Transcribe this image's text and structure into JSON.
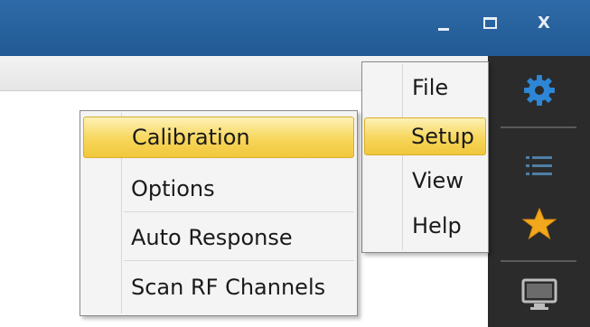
{
  "window": {
    "minimize_icon": "minimize-icon",
    "maximize_icon": "maximize-icon",
    "close_label": "X"
  },
  "main_menu": {
    "items": [
      {
        "label": "File",
        "selected": false
      },
      {
        "label": "Setup",
        "selected": true
      },
      {
        "label": "View",
        "selected": false
      },
      {
        "label": "Help",
        "selected": false
      }
    ]
  },
  "setup_submenu": {
    "items": [
      {
        "label": "Calibration",
        "selected": true
      },
      {
        "label": "Options",
        "selected": false
      },
      {
        "label": "Auto Response",
        "selected": false
      },
      {
        "label": "Scan RF Channels",
        "selected": false
      }
    ]
  },
  "sidebar": {
    "buttons": [
      {
        "icon": "gear-icon"
      },
      {
        "icon": "list-icon"
      },
      {
        "icon": "star-icon"
      },
      {
        "icon": "monitor-icon"
      }
    ]
  },
  "colors": {
    "titlebar": "#215a94",
    "sidebar": "#2b2b2b",
    "highlight": "#f7d65a",
    "gear": "#2e86d6",
    "star": "#f2a81c"
  }
}
